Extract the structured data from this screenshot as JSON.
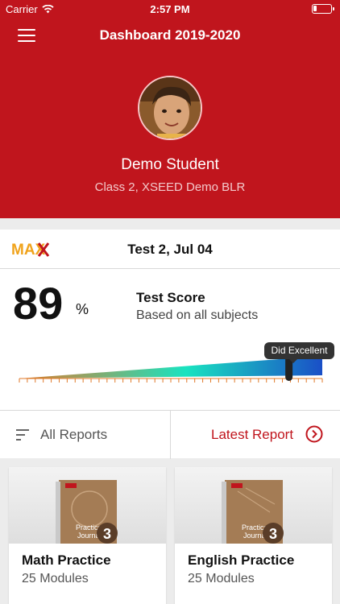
{
  "status_bar": {
    "carrier": "Carrier",
    "time": "2:57 PM",
    "battery_level": 0.18
  },
  "header": {
    "title": "Dashboard 2019-2020",
    "student_name": "Demo Student",
    "student_class": "Class 2, XSEED Demo BLR",
    "menu_icon": "hamburger-menu-icon"
  },
  "test": {
    "logo": "MAX",
    "title": "Test 2, Jul 04",
    "score": "89",
    "score_unit": "%",
    "score_label": "Test Score",
    "score_sub": "Based on all subjects",
    "gauge_tooltip": "Did Excellent",
    "gauge_value": 89
  },
  "reports": {
    "all_label": "All Reports",
    "latest_label": "Latest Report",
    "filter_icon": "filter-icon",
    "latest_icon": "chevron-right-circle-icon"
  },
  "practice": [
    {
      "title": "Math Practice",
      "modules": "25 Modules",
      "book_number": "3",
      "book_label": "Practice Journal"
    },
    {
      "title": "English Practice",
      "modules": "25 Modules",
      "book_number": "3",
      "book_label": "Practice Journal"
    }
  ],
  "colors": {
    "brand_red": "#c0151d",
    "gauge_start": "#e07a2a",
    "gauge_mid": "#19e3c0",
    "gauge_end": "#1a4fc7"
  }
}
